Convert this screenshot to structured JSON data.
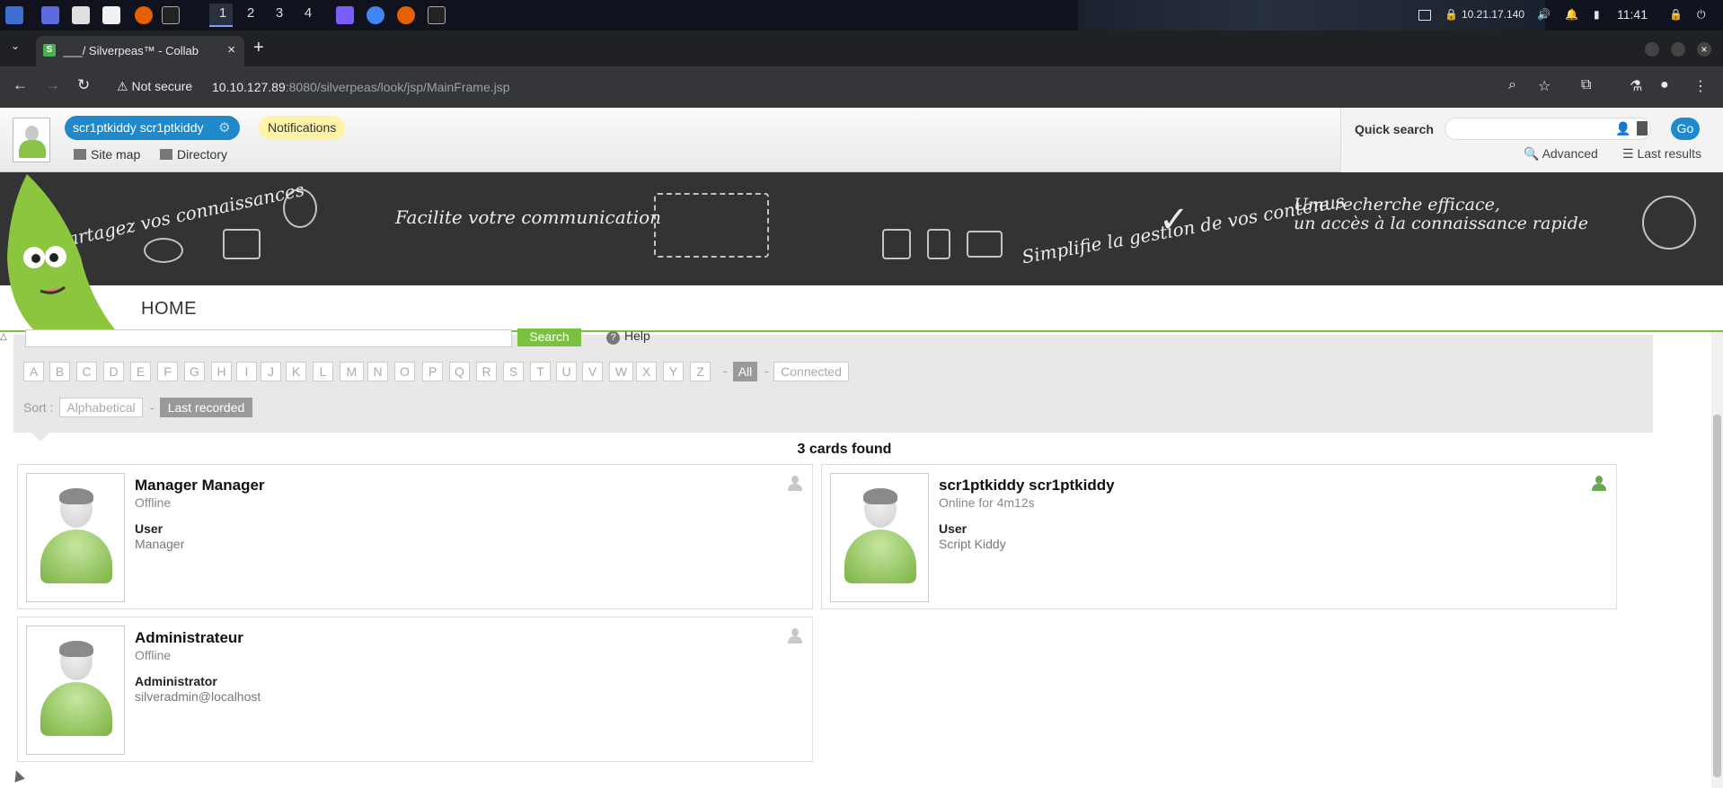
{
  "taskbar": {
    "workspaces": [
      "1",
      "2",
      "3",
      "4"
    ],
    "ip": "10.21.17.140",
    "clock": "11:41"
  },
  "browser": {
    "tab_title": "___/ Silverpeas™ - Collab",
    "tab_favicon": "S",
    "new_tab": "+",
    "not_secure": "Not secure",
    "url_host": "10.10.127.89",
    "url_path": ":8080/silverpeas/look/jsp/MainFrame.jsp"
  },
  "header": {
    "user_name": "scr1ptkiddy scr1ptkiddy",
    "notifications": "Notifications",
    "site_map": "Site map",
    "directory": "Directory",
    "quick_search_label": "Quick search",
    "go": "Go",
    "advanced": "Advanced",
    "last_results": "Last results"
  },
  "banner": {
    "text1": "Partagez vos connaissances",
    "text2": "Facilite votre communication",
    "text3": "Simplifie la gestion de vos contenus",
    "text4a": "Une recherche efficace,",
    "text4b": "un accès à la connaissance rapide"
  },
  "nav": {
    "home": "HOME"
  },
  "directory": {
    "search_button": "Search",
    "help": "Help",
    "letters": [
      "A",
      "B",
      "C",
      "D",
      "E",
      "F",
      "G",
      "H",
      "I",
      "J",
      "K",
      "L",
      "M",
      "N",
      "O",
      "P",
      "Q",
      "R",
      "S",
      "T",
      "U",
      "V",
      "W",
      "X",
      "Y",
      "Z"
    ],
    "all": "All",
    "connected": "Connected",
    "sort_label": "Sort :",
    "sort_alpha": "Alphabetical",
    "sort_last": "Last recorded",
    "cards_found": "3 cards found"
  },
  "cards": [
    {
      "name": "Manager Manager",
      "status": "Offline",
      "role": "User",
      "extra": "Manager",
      "online": false
    },
    {
      "name": "scr1ptkiddy scr1ptkiddy",
      "status": "Online for 4m12s",
      "role": "User",
      "extra": "Script Kiddy",
      "online": true
    },
    {
      "name": "Administrateur",
      "status": "Offline",
      "role": "Administrator",
      "extra": "silveradmin@localhost",
      "online": false
    }
  ]
}
